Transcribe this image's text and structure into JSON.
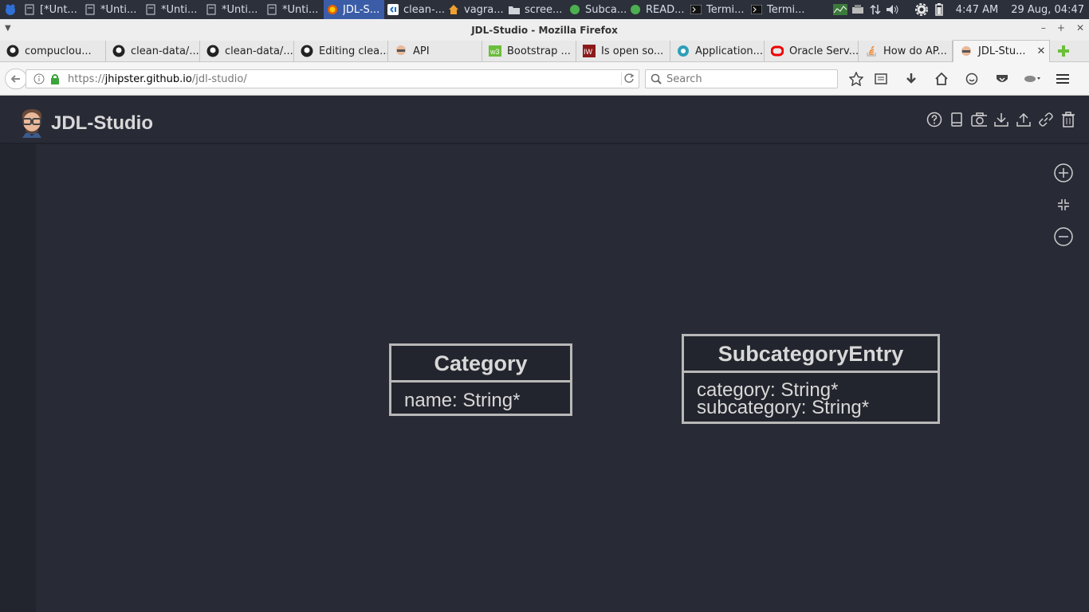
{
  "taskbar": {
    "tasks": [
      {
        "label": "[*Unt...",
        "icon": "document-icon",
        "active": false
      },
      {
        "label": "*Unti...",
        "icon": "document-icon",
        "active": false
      },
      {
        "label": "*Unti...",
        "icon": "document-icon",
        "active": false
      },
      {
        "label": "*Unti...",
        "icon": "document-icon",
        "active": false
      },
      {
        "label": "*Unti...",
        "icon": "document-icon",
        "active": false
      },
      {
        "label": "JDL-S...",
        "icon": "firefox-icon",
        "active": true
      },
      {
        "label": "clean-...",
        "icon": "vscode-icon",
        "active": false
      },
      {
        "label": "vagra...",
        "icon": "home-folder-icon",
        "active": false
      },
      {
        "label": "scree...",
        "icon": "folder-icon",
        "active": false
      },
      {
        "label": "Subca...",
        "icon": "green-globe-icon",
        "active": false
      },
      {
        "label": "READ...",
        "icon": "green-globe-icon",
        "active": false
      },
      {
        "label": "Termi...",
        "icon": "terminal-icon",
        "active": false
      },
      {
        "label": "Termi...",
        "icon": "terminal-icon",
        "active": false
      }
    ],
    "clock": "4:47 AM",
    "date": "29 Aug, 04:47"
  },
  "window": {
    "title": "JDL-Studio - Mozilla Firefox"
  },
  "browser": {
    "tabs": [
      {
        "label": "compuclou...",
        "icon": "github-icon"
      },
      {
        "label": "clean-data/...",
        "icon": "github-icon"
      },
      {
        "label": "clean-data/...",
        "icon": "github-icon"
      },
      {
        "label": "Editing clea...",
        "icon": "github-icon"
      },
      {
        "label": "API",
        "icon": "jhipster-icon"
      },
      {
        "label": "Bootstrap ...",
        "icon": "w3-icon"
      },
      {
        "label": "Is open so...",
        "icon": "iw-icon"
      },
      {
        "label": "Application...",
        "icon": "openshift-icon"
      },
      {
        "label": "Oracle Serv...",
        "icon": "oracle-icon"
      },
      {
        "label": "How do AP...",
        "icon": "stackoverflow-icon"
      },
      {
        "label": "JDL-Stu...",
        "icon": "jhipster-icon",
        "active": true
      }
    ],
    "url_scheme": "https://",
    "url_host": "jhipster.github.io",
    "url_path": "/jdl-studio/",
    "search_placeholder": "Search"
  },
  "app": {
    "title": "JDL-Studio",
    "colors": {
      "background": "#282a36",
      "entity_border": "#b8b8b8",
      "text": "#d8d8d8"
    },
    "entities": [
      {
        "name": "Category",
        "fields": [
          "name: String*"
        ]
      },
      {
        "name": "SubcategoryEntry",
        "fields": [
          "category: String*",
          "subcategory: String*"
        ]
      }
    ]
  }
}
